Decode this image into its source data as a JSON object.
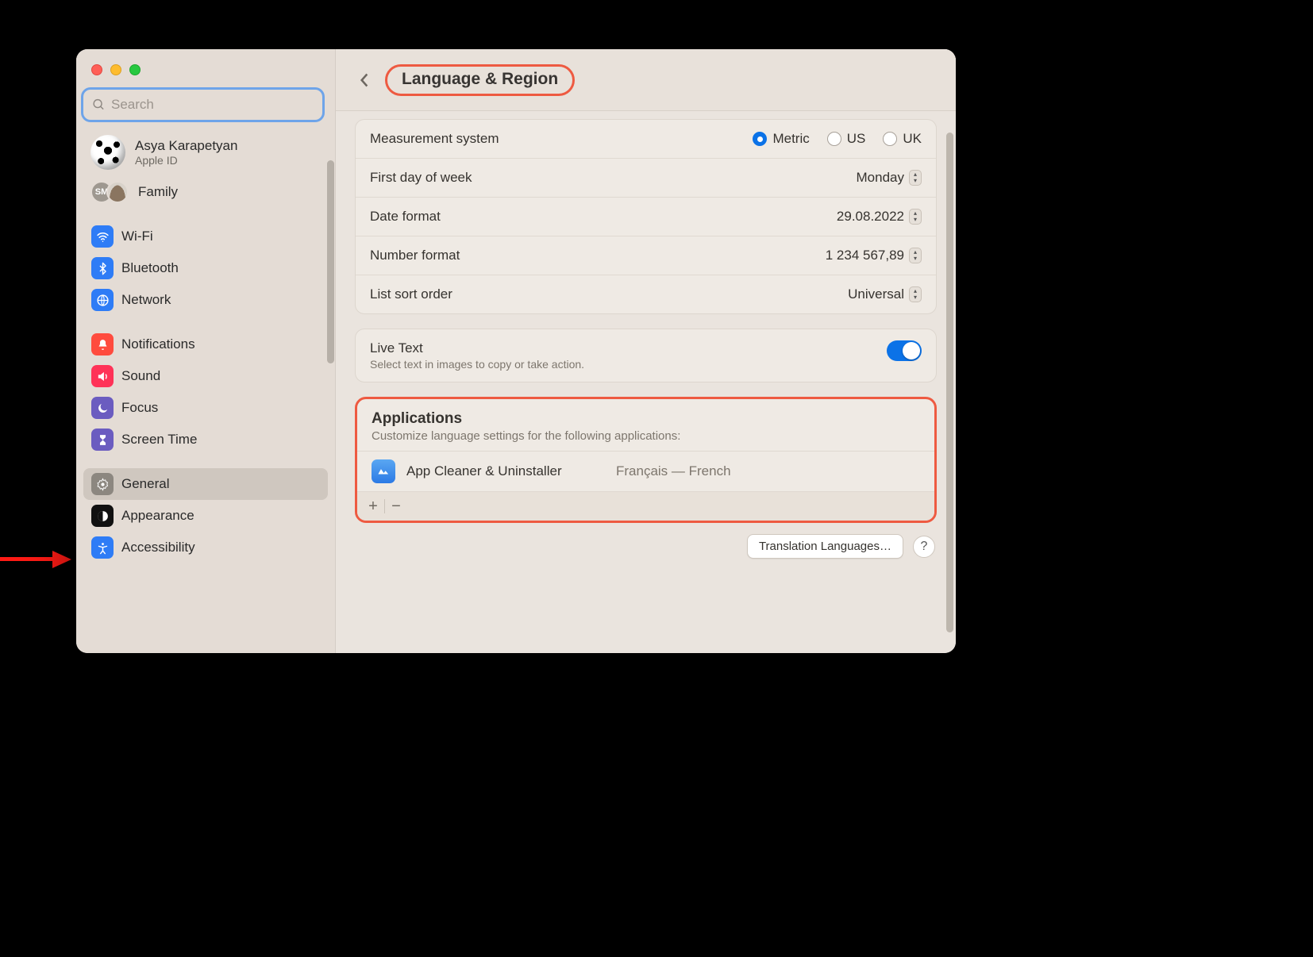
{
  "window": {
    "traffic": [
      "close",
      "minimize",
      "zoom"
    ]
  },
  "sidebar": {
    "search_placeholder": "Search",
    "account": {
      "name": "Asya Karapetyan",
      "sub": "Apple ID"
    },
    "family": {
      "label": "Family",
      "badge_sm": "SM"
    },
    "groups": [
      {
        "items": [
          {
            "id": "wifi",
            "icon": "wifi",
            "label": "Wi-Fi"
          },
          {
            "id": "bluetooth",
            "icon": "bt",
            "label": "Bluetooth"
          },
          {
            "id": "network",
            "icon": "net",
            "label": "Network"
          }
        ]
      },
      {
        "items": [
          {
            "id": "notifications",
            "icon": "notif",
            "label": "Notifications"
          },
          {
            "id": "sound",
            "icon": "sound",
            "label": "Sound"
          },
          {
            "id": "focus",
            "icon": "focus",
            "label": "Focus"
          },
          {
            "id": "screentime",
            "icon": "st",
            "label": "Screen Time"
          }
        ]
      },
      {
        "items": [
          {
            "id": "general",
            "icon": "gen",
            "label": "General",
            "selected": true
          },
          {
            "id": "appearance",
            "icon": "app",
            "label": "Appearance"
          },
          {
            "id": "accessibility",
            "icon": "acc",
            "label": "Accessibility"
          }
        ]
      }
    ]
  },
  "header": {
    "title": "Language & Region"
  },
  "settings": {
    "measurement": {
      "label": "Measurement system",
      "options": [
        {
          "id": "metric",
          "label": "Metric",
          "selected": true
        },
        {
          "id": "us",
          "label": "US",
          "selected": false
        },
        {
          "id": "uk",
          "label": "UK",
          "selected": false
        }
      ]
    },
    "first_day": {
      "label": "First day of week",
      "value": "Monday"
    },
    "date_format": {
      "label": "Date format",
      "value": "29.08.2022"
    },
    "number_format": {
      "label": "Number format",
      "value": "1 234 567,89"
    },
    "list_sort": {
      "label": "List sort order",
      "value": "Universal"
    },
    "live_text": {
      "label": "Live Text",
      "sub": "Select text in images to copy or take action.",
      "on": true
    }
  },
  "applications": {
    "title": "Applications",
    "sub": "Customize language settings for the following applications:",
    "items": [
      {
        "name": "App Cleaner & Uninstaller",
        "language": "Français — French"
      }
    ],
    "add_label": "+",
    "remove_label": "−"
  },
  "footer": {
    "translation_button": "Translation Languages…",
    "help": "?"
  }
}
